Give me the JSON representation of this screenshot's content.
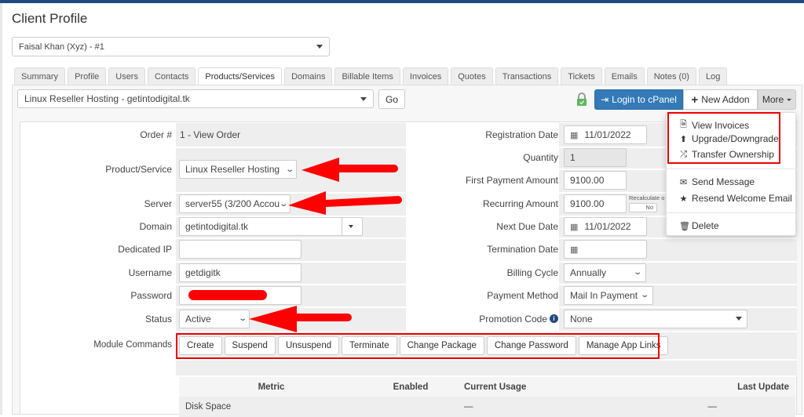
{
  "page_title": "Client Profile",
  "client_select": "Faisal Khan (Xyz) - #1",
  "tabs": [
    "Summary",
    "Profile",
    "Users",
    "Contacts",
    "Products/Services",
    "Domains",
    "Billable Items",
    "Invoices",
    "Quotes",
    "Transactions",
    "Tickets",
    "Emails",
    "Notes (0)",
    "Log"
  ],
  "active_tab": "Products/Services",
  "service_select": "Linux Reseller Hosting - getintodigital.tk",
  "go_label": "Go",
  "toolbar": {
    "login_cpanel": "Login to cPanel",
    "new_addon": "New Addon",
    "more": "More",
    "accent": "#337ab7"
  },
  "more_menu": {
    "items": [
      {
        "label": "View Invoices",
        "icon": "file-icon"
      },
      {
        "label": "Upgrade/Downgrade",
        "icon": "upload-circle-icon"
      },
      {
        "label": "Transfer Ownership",
        "icon": "shuffle-icon"
      },
      {
        "label": "Send Message",
        "icon": "envelope-icon"
      },
      {
        "label": "Resend Welcome Email",
        "icon": "star-icon"
      },
      {
        "label": "Delete",
        "icon": "trash-icon"
      }
    ]
  },
  "left": {
    "order_label": "Order #",
    "order_value": "1 - View Order",
    "product_label": "Product/Service",
    "product_value": "Linux Reseller Hosting",
    "server_label": "Server",
    "server_value": "server55 (3/200 Accou",
    "domain_label": "Domain",
    "domain_value": "getintodigital.tk",
    "dedicated_ip_label": "Dedicated IP",
    "dedicated_ip_value": "",
    "username_label": "Username",
    "username_value": "getdigitk",
    "password_label": "Password",
    "status_label": "Status",
    "status_value": "Active",
    "module_label": "Module Commands"
  },
  "module_commands": [
    "Create",
    "Suspend",
    "Unsuspend",
    "Terminate",
    "Change Package",
    "Change Password",
    "Manage App Links"
  ],
  "right": {
    "reg_date_label": "Registration Date",
    "reg_date_value": "11/01/2022",
    "quantity_label": "Quantity",
    "quantity_value": "1",
    "first_payment_label": "First Payment Amount",
    "first_payment_value": "9100.00",
    "recurring_label": "Recurring Amount",
    "recurring_value": "9100.00",
    "recalculate_label": "Recalculate o",
    "recalculate_toggle": "No",
    "next_due_label": "Next Due Date",
    "next_due_value": "11/01/2022",
    "termination_label": "Termination Date",
    "termination_value": "",
    "billing_cycle_label": "Billing Cycle",
    "billing_cycle_value": "Annually",
    "payment_method_label": "Payment Method",
    "payment_method_value": "Mail In Payment",
    "promo_label": "Promotion Code",
    "promo_value": "None"
  },
  "metrics_table": {
    "headers": [
      "Metric",
      "Enabled",
      "Current Usage",
      "Last Update"
    ],
    "rows": [
      [
        "Disk Space",
        "",
        "—",
        "—"
      ]
    ]
  }
}
